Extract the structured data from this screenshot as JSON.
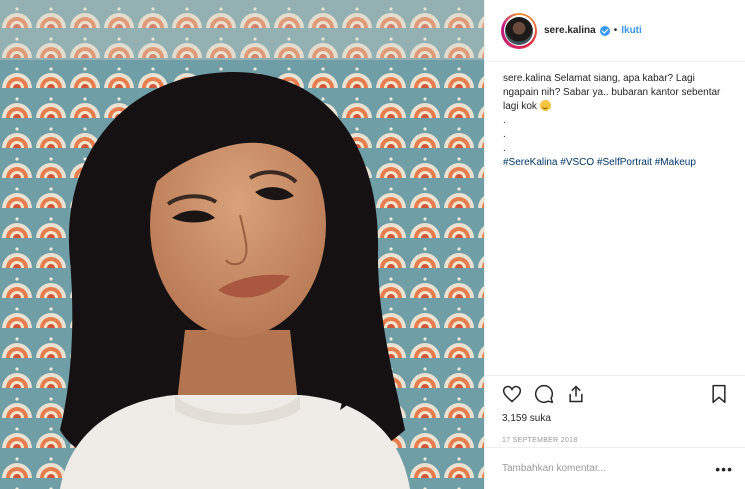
{
  "header": {
    "username": "sere.kalina",
    "separator": "•",
    "follow_label": "Ikuti"
  },
  "caption": {
    "username": "sere.kalina",
    "text": "Selamat siang, apa kabar? Lagi ngapain nih? Sabar ya.. bubaran kantor sebentar lagi kok",
    "dots": [
      ".",
      ".",
      "."
    ],
    "hashtags": "#SereKalina #VSCO #SelfPortrait #Makeup"
  },
  "likes": "3,159 suka",
  "date": "17 SEPTEMBER 2018",
  "comment": {
    "placeholder": "Tambahkan komentar...",
    "more_label": "•••"
  },
  "icons": {
    "like": "heart-icon",
    "comment": "comment-icon",
    "share": "share-icon",
    "save": "bookmark-icon"
  },
  "colors": {
    "link": "#3897f0",
    "hashtag": "#003569",
    "muted": "#999999"
  }
}
